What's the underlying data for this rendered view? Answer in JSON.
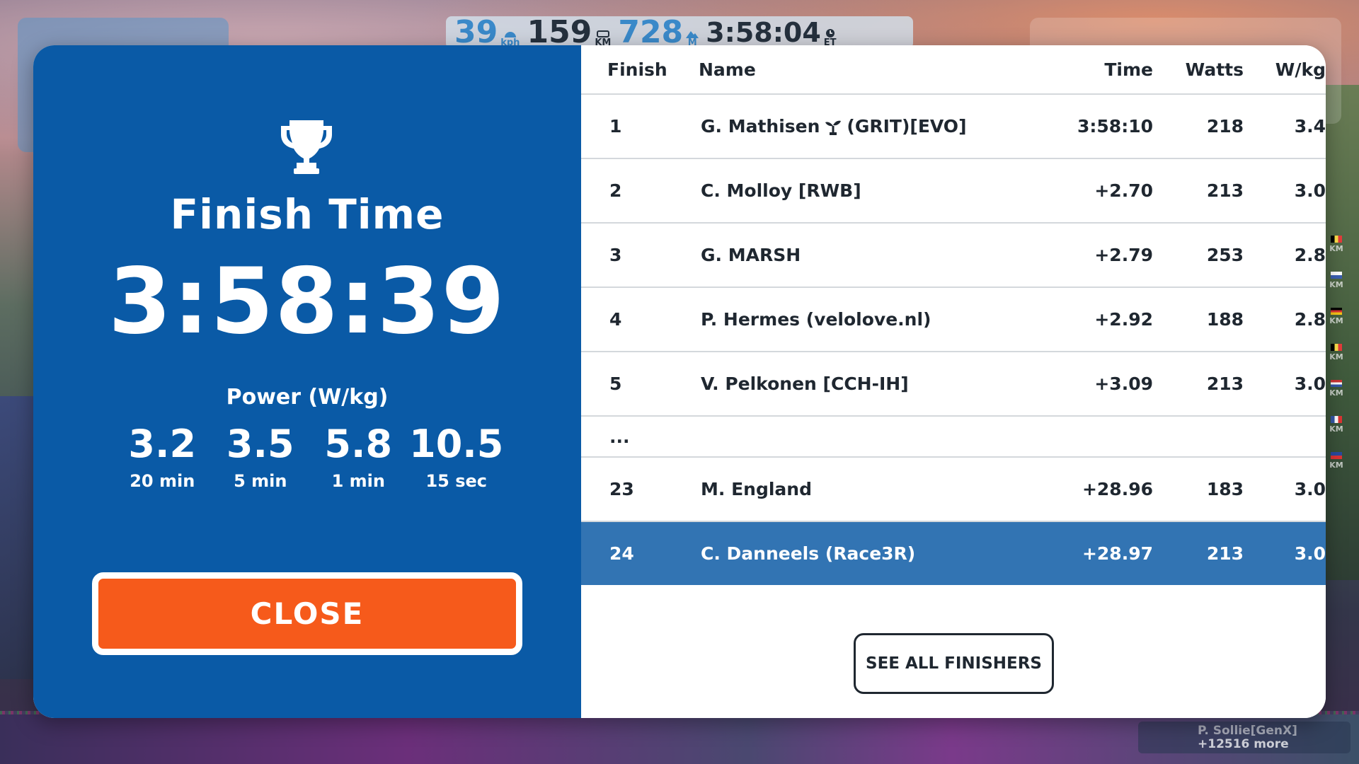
{
  "hud": {
    "speed": "39",
    "speed_unit": "kph",
    "distance": "159",
    "distance_unit": "KM",
    "elevation": "728",
    "elevation_unit": "M",
    "elapsed": "3:58:04",
    "elapsed_unit": "ET"
  },
  "background": {
    "more_riders_name": "P. Sollie[GenX]",
    "more_riders_count": "+12516 more",
    "sliver_unit": "KM"
  },
  "finish_panel": {
    "title": "Finish Time",
    "time": "3:58:39",
    "power_label": "Power (W/kg)",
    "power": [
      {
        "value": "3.2",
        "duration": "20 min"
      },
      {
        "value": "3.5",
        "duration": "5 min"
      },
      {
        "value": "5.8",
        "duration": "1 min"
      },
      {
        "value": "10.5",
        "duration": "15 sec"
      }
    ],
    "close_label": "CLOSE",
    "icon": "trophy-icon"
  },
  "results": {
    "headers": {
      "finish": "Finish",
      "name": "Name",
      "time": "Time",
      "watts": "Watts",
      "wkg": "W/kg"
    },
    "rows": [
      {
        "finish": "1",
        "name": "G. Mathisen",
        "name_suffix": "(GRIT)[EVO]",
        "time": "3:58:10",
        "watts": "218",
        "wkg": "3.4"
      },
      {
        "finish": "2",
        "name": "C. Molloy [RWB]",
        "time": "+2.70",
        "watts": "213",
        "wkg": "3.0"
      },
      {
        "finish": "3",
        "name": "G. MARSH",
        "time": "+2.79",
        "watts": "253",
        "wkg": "2.8"
      },
      {
        "finish": "4",
        "name": "P. Hermes (velolove.nl)",
        "time": "+2.92",
        "watts": "188",
        "wkg": "2.8"
      },
      {
        "finish": "5",
        "name": "V. Pelkonen [CCH-IH]",
        "time": "+3.09",
        "watts": "213",
        "wkg": "3.0"
      }
    ],
    "ellipsis": "...",
    "tail_rows": [
      {
        "finish": "23",
        "name": "M. England",
        "time": "+28.96",
        "watts": "183",
        "wkg": "3.0"
      },
      {
        "finish": "24",
        "name": "C. Danneels (Race3R)",
        "time": "+28.97",
        "watts": "213",
        "wkg": "3.0"
      }
    ],
    "see_all_label": "SEE ALL FINISHERS"
  },
  "colors": {
    "panel_blue": "#0a5aa6",
    "highlight_row": "#3274b3",
    "close_orange": "#f65a1b"
  }
}
